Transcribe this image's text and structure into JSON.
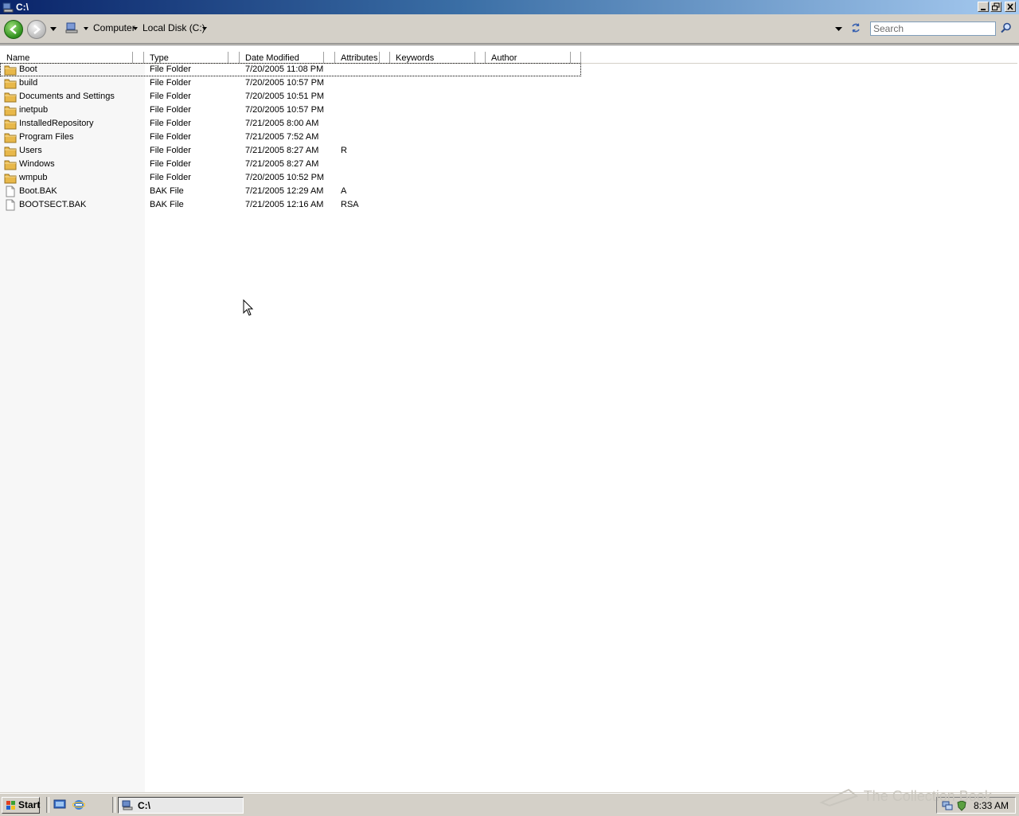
{
  "window": {
    "title": "C:\\",
    "controls": [
      "minimize",
      "restore",
      "close"
    ]
  },
  "toolbar": {
    "breadcrumb": [
      "Computer",
      "Local Disk (C:)"
    ],
    "search_placeholder": "Search"
  },
  "columns": [
    "Name",
    "Type",
    "Date Modified",
    "Attributes",
    "Keywords",
    "Author"
  ],
  "files": [
    {
      "name": "Boot",
      "type": "File Folder",
      "date": "7/20/2005 11:08 PM",
      "attr": "",
      "kind": "folder"
    },
    {
      "name": "build",
      "type": "File Folder",
      "date": "7/20/2005 10:57 PM",
      "attr": "",
      "kind": "folder"
    },
    {
      "name": "Documents and Settings",
      "type": "File Folder",
      "date": "7/20/2005 10:51 PM",
      "attr": "",
      "kind": "folder"
    },
    {
      "name": "inetpub",
      "type": "File Folder",
      "date": "7/20/2005 10:57 PM",
      "attr": "",
      "kind": "folder"
    },
    {
      "name": "InstalledRepository",
      "type": "File Folder",
      "date": "7/21/2005 8:00 AM",
      "attr": "",
      "kind": "folder"
    },
    {
      "name": "Program Files",
      "type": "File Folder",
      "date": "7/21/2005 7:52 AM",
      "attr": "",
      "kind": "folder"
    },
    {
      "name": "Users",
      "type": "File Folder",
      "date": "7/21/2005 8:27 AM",
      "attr": "R",
      "kind": "folder"
    },
    {
      "name": "Windows",
      "type": "File Folder",
      "date": "7/21/2005 8:27 AM",
      "attr": "",
      "kind": "folder"
    },
    {
      "name": "wmpub",
      "type": "File Folder",
      "date": "7/20/2005 10:52 PM",
      "attr": "",
      "kind": "folder"
    },
    {
      "name": "Boot.BAK",
      "type": "BAK File",
      "date": "7/21/2005 12:29 AM",
      "attr": "A",
      "kind": "file"
    },
    {
      "name": "BOOTSECT.BAK",
      "type": "BAK File",
      "date": "7/21/2005 12:16 AM",
      "attr": "RSA",
      "kind": "file"
    }
  ],
  "taskbar": {
    "start_label": "Start",
    "task_label": "C:\\",
    "clock": "8:33 AM"
  },
  "watermark": "The Collection Book",
  "colors": {
    "titlebar_start": "#0a246a",
    "titlebar_end": "#a6caf0",
    "folder": "#e8b84a",
    "chrome": "#d4d0c8"
  }
}
